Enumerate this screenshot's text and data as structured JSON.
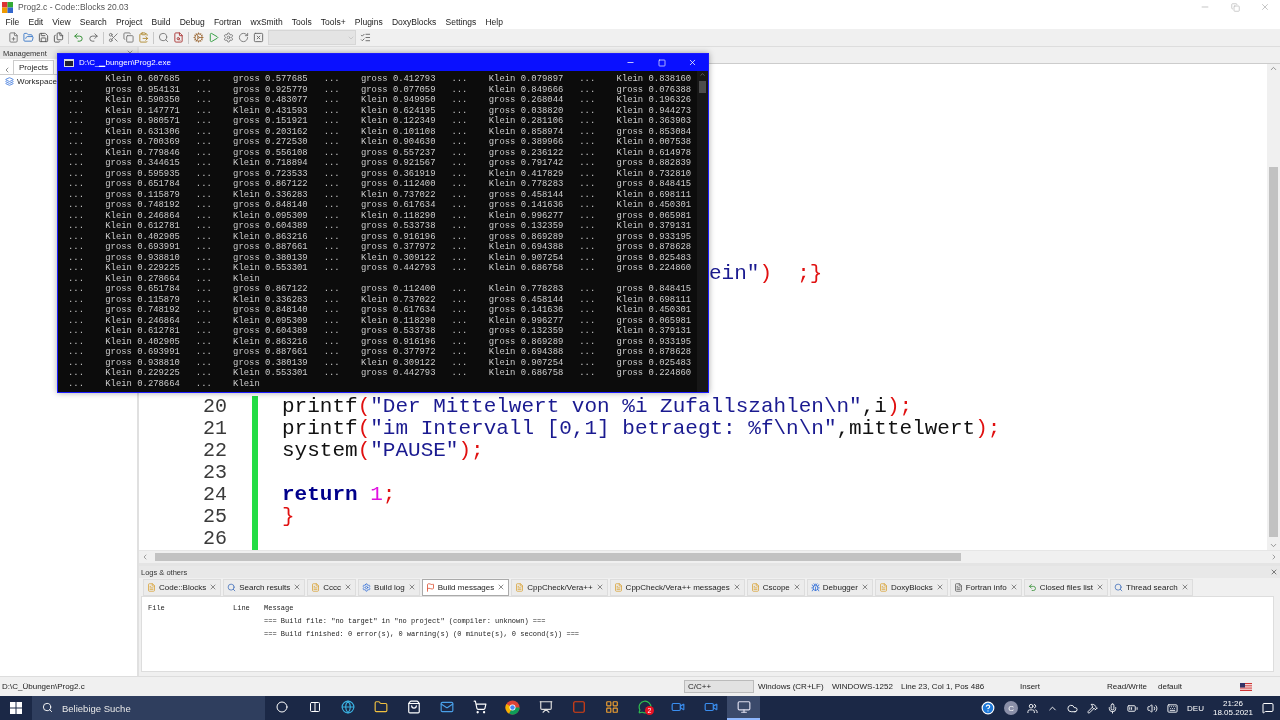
{
  "window": {
    "title": "Prog2.c - Code::Blocks 20.03"
  },
  "menu": [
    "File",
    "Edit",
    "View",
    "Search",
    "Project",
    "Build",
    "Debug",
    "Fortran",
    "wxSmith",
    "Tools",
    "Tools+",
    "Plugins",
    "DoxyBlocks",
    "Settings",
    "Help"
  ],
  "management": {
    "title": "Management",
    "tabs": [
      {
        "label": "Projects",
        "selected": true
      }
    ],
    "tree": [
      {
        "label": "Workspace"
      }
    ]
  },
  "editor": {
    "lines": [
      {
        "kind": "tail",
        "tokens": [
          {
            "t": "ein\"",
            "kind": "str"
          },
          {
            "t": ")  ;}",
            "kind": "op"
          }
        ]
      },
      {
        "kind": "full",
        "number": "20",
        "changed": true,
        "tokens": [
          {
            "t": "printf",
            "kind": "plain"
          },
          {
            "t": "(",
            "kind": "op"
          },
          {
            "t": "\"Der Mittelwert von %i Zufallszahlen\\n\"",
            "kind": "str"
          },
          {
            "t": ",i",
            "kind": "plain"
          },
          {
            "t": ");",
            "kind": "op"
          }
        ]
      },
      {
        "kind": "full",
        "number": "21",
        "changed": true,
        "tokens": [
          {
            "t": "printf",
            "kind": "plain"
          },
          {
            "t": "(",
            "kind": "op"
          },
          {
            "t": "\"im Intervall [0,1] betraegt: %f\\n\\n\"",
            "kind": "str"
          },
          {
            "t": ",mittelwert",
            "kind": "plain"
          },
          {
            "t": ");",
            "kind": "op"
          }
        ]
      },
      {
        "kind": "full",
        "number": "22",
        "changed": true,
        "tokens": [
          {
            "t": "system",
            "kind": "plain"
          },
          {
            "t": "(",
            "kind": "op"
          },
          {
            "t": "\"PAUSE\"",
            "kind": "str"
          },
          {
            "t": ");",
            "kind": "op"
          }
        ]
      },
      {
        "kind": "full",
        "number": "23",
        "changed": true
      },
      {
        "kind": "full",
        "number": "24",
        "changed": true,
        "tokens": [
          {
            "t": "return",
            "kind": "kw"
          },
          {
            "t": " 1",
            "kind": "num"
          },
          {
            "t": ";",
            "kind": "op"
          }
        ]
      },
      {
        "kind": "full",
        "number": "25",
        "changed": true,
        "tokens": [
          {
            "t": "}",
            "kind": "op"
          }
        ]
      },
      {
        "kind": "full",
        "number": "26",
        "changed": true
      }
    ]
  },
  "console": {
    "title": "D:\\C_▁bungen\\Prog2.exe",
    "lines": [
      "...    Klein 0.607685   ...    gross 0.577685   ...    gross 0.412793   ...    Klein 0.079897   ...    Klein 0.838160",
      "...    gross 0.954131   ...    gross 0.925779   ...    gross 0.077059   ...    Klein 0.849666   ...    gross 0.076388",
      "...    Klein 0.590350   ...    gross 0.483077   ...    Klein 0.949950   ...    gross 0.268044   ...    Klein 0.196326",
      "...    Klein 0.147771   ...    Klein 0.431593   ...    Klein 0.624195   ...    gross 0.038820   ...    Klein 0.944273",
      "...    gross 0.980571   ...    gross 0.151921   ...    Klein 0.122349   ...    Klein 0.281106   ...    Klein 0.363903",
      "...    Klein 0.631306   ...    gross 0.203162   ...    Klein 0.101108   ...    Klein 0.858974   ...    gross 0.853084",
      "...    gross 0.700369   ...    gross 0.272530   ...    Klein 0.904630   ...    gross 0.389966   ...    Klein 0.007538",
      "...    Klein 0.779846   ...    gross 0.556108   ...    gross 0.557237   ...    gross 0.236122   ...    Klein 0.614978",
      "...    gross 0.344615   ...    Klein 0.718894   ...    gross 0.921567   ...    gross 0.791742   ...    gross 0.882839",
      "...    gross 0.595935   ...    gross 0.723533   ...    gross 0.361919   ...    Klein 0.417829   ...    Klein 0.732810",
      "...    gross 0.651784   ...    gross 0.867122   ...    gross 0.112400   ...    Klein 0.778283   ...    gross 0.848415",
      "...    gross 0.115879   ...    Klein 0.336283   ...    Klein 0.737022   ...    gross 0.458144   ...    Klein 0.698111",
      "...    gross 0.748192   ...    gross 0.848140   ...    gross 0.617634   ...    gross 0.141636   ...    Klein 0.450301",
      "...    Klein 0.246864   ...    Klein 0.095309   ...    Klein 0.118290   ...    Klein 0.996277   ...    gross 0.065981",
      "...    Klein 0.612781   ...    gross 0.604389   ...    gross 0.533738   ...    gross 0.132359   ...    Klein 0.379131",
      "...    Klein 0.402905   ...    Klein 0.863216   ...    gross 0.916196   ...    gross 0.869289   ...    gross 0.933195",
      "...    gross 0.693991   ...    gross 0.887661   ...    gross 0.377972   ...    Klein 0.694388   ...    gross 0.878628",
      "...    gross 0.938810   ...    gross 0.380139   ...    Klein 0.309122   ...    Klein 0.907254   ...    gross 0.025483",
      "...    Klein 0.229225   ...    Klein 0.553301   ...    gross 0.442793   ...    Klein 0.686758   ...    gross 0.224860",
      "...    Klein 0.278664   ...    Klein",
      "...    gross 0.651784   ...    gross 0.867122   ...    gross 0.112400   ...    Klein 0.778283   ...    gross 0.848415",
      "...    gross 0.115879   ...    Klein 0.336283   ...    Klein 0.737022   ...    gross 0.458144   ...    Klein 0.698111",
      "...    gross 0.748192   ...    gross 0.848140   ...    gross 0.617634   ...    gross 0.141636   ...    Klein 0.450301",
      "...    Klein 0.246864   ...    Klein 0.095309   ...    Klein 0.118290   ...    Klein 0.996277   ...    gross 0.065981",
      "...    Klein 0.612781   ...    gross 0.604389   ...    gross 0.533738   ...    gross 0.132359   ...    Klein 0.379131",
      "...    Klein 0.402905   ...    Klein 0.863216   ...    gross 0.916196   ...    gross 0.869289   ...    gross 0.933195",
      "...    gross 0.693991   ...    gross 0.887661   ...    gross 0.377972   ...    Klein 0.694388   ...    gross 0.878628",
      "...    gross 0.938810   ...    gross 0.380139   ...    Klein 0.309122   ...    Klein 0.907254   ...    gross 0.025483",
      "...    Klein 0.229225   ...    Klein 0.553301   ...    gross 0.442793   ...    Klein 0.686758   ...    gross 0.224860",
      "...    Klein 0.278664   ...    Klein"
    ]
  },
  "logs": {
    "title": "Logs & others",
    "tabs": [
      {
        "label": "Code::Blocks",
        "selected": false
      },
      {
        "label": "Search results",
        "selected": false
      },
      {
        "label": "Cccc",
        "selected": false
      },
      {
        "label": "Build log",
        "selected": false
      },
      {
        "label": "Build messages",
        "selected": true
      },
      {
        "label": "CppCheck/Vera++",
        "selected": false
      },
      {
        "label": "CppCheck/Vera++ messages",
        "selected": false
      },
      {
        "label": "Cscope",
        "selected": false
      },
      {
        "label": "Debugger",
        "selected": false
      },
      {
        "label": "DoxyBlocks",
        "selected": false
      },
      {
        "label": "Fortran info",
        "selected": false
      },
      {
        "label": "Closed files list",
        "selected": false
      },
      {
        "label": "Thread search",
        "selected": false
      }
    ],
    "columns": [
      "File",
      "Line",
      "Message"
    ],
    "rows": [
      {
        "message": "=== Build file: \"no target\" in \"no project\" (compiler: unknown) ==="
      },
      {
        "message": "=== Build finished: 0 error(s), 0 warning(s) (0 minute(s), 0 second(s)) ==="
      }
    ]
  },
  "status_bar": {
    "path": "D:\\C_Übungen\\Prog2.c",
    "fields": [
      "C/C++",
      "Windows (CR+LF)",
      "WINDOWS-1252",
      "Line 23, Col 1, Pos 486",
      "Insert",
      "Read/Write",
      "default"
    ]
  },
  "taskbar": {
    "search": {
      "placeholder": "Beliebige Suche"
    },
    "apps": [
      {
        "active": false
      },
      {
        "active": false
      },
      {
        "active": false
      },
      {
        "active": false
      },
      {
        "active": false
      },
      {
        "active": false
      },
      {
        "active": false
      },
      {
        "active": false
      },
      {
        "active": false
      },
      {
        "active": false,
        "badge": "2"
      },
      {
        "active": false
      },
      {
        "active": false
      },
      {
        "active": true
      }
    ],
    "avatar": "C",
    "language": "DEU",
    "time": "21:26",
    "date": "18.05.2021"
  }
}
